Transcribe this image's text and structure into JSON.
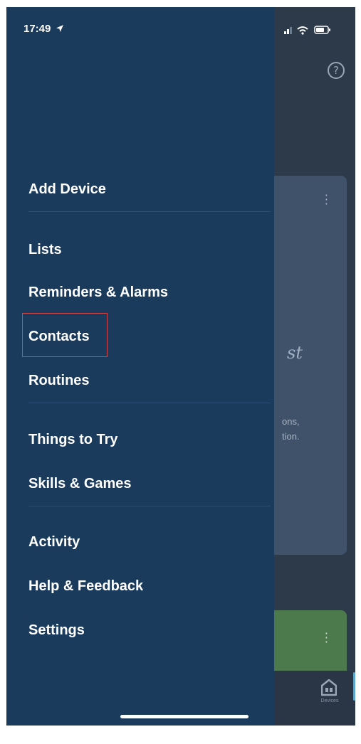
{
  "status_bar": {
    "time": "17:49"
  },
  "menu": {
    "items": [
      {
        "label": "Add Device"
      },
      {
        "label": "Lists"
      },
      {
        "label": "Reminders & Alarms"
      },
      {
        "label": "Contacts"
      },
      {
        "label": "Routines"
      },
      {
        "label": "Things to Try"
      },
      {
        "label": "Skills & Games"
      },
      {
        "label": "Activity"
      },
      {
        "label": "Help & Feedback"
      },
      {
        "label": "Settings"
      }
    ]
  },
  "background": {
    "card_partial_italic": "st",
    "card_partial_text_1": "ons,",
    "card_partial_text_2": "tion.",
    "tab_devices_label": "Devices"
  },
  "colors": {
    "drawer_bg": "#1b3b5c",
    "highlight_border": "#d64545",
    "card_green": "#4c7a4c"
  },
  "icons": {
    "help": "question-circle",
    "location": "location-arrow",
    "devices": "house-devices",
    "signal": "cellular-signal",
    "wifi": "wifi",
    "battery": "battery"
  }
}
